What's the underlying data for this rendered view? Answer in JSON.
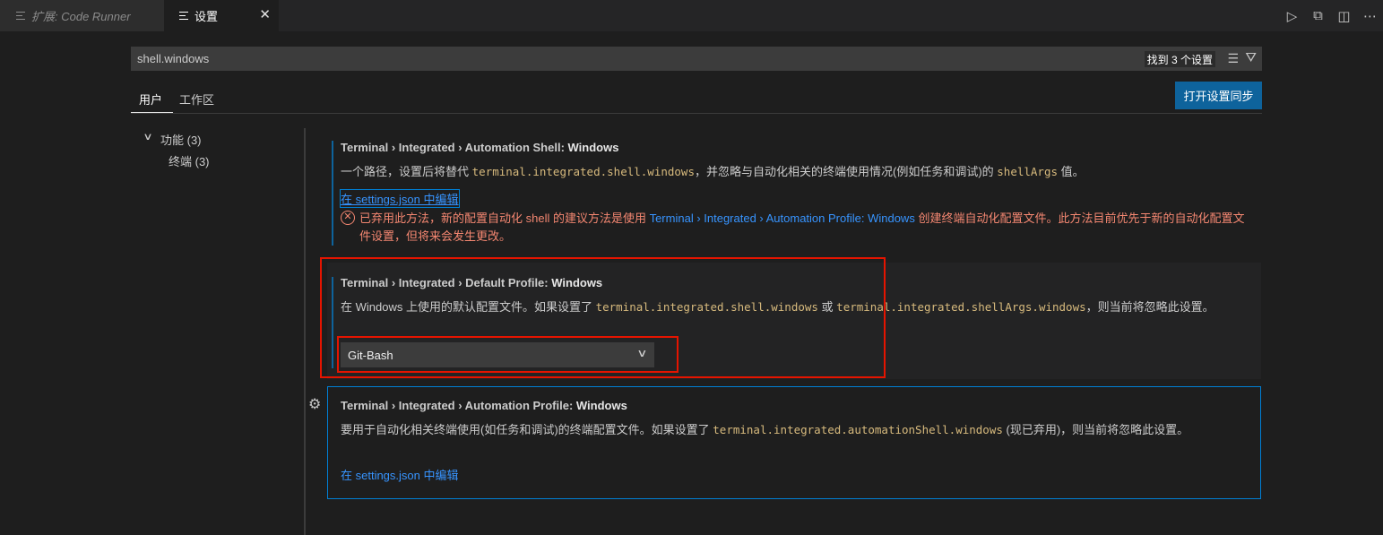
{
  "tabs": [
    {
      "label": "扩展: Code Runner",
      "active": false
    },
    {
      "label": "设置",
      "active": true
    }
  ],
  "tab_close": "✕",
  "editor_actions": [
    "run-icon",
    "open-settings-json-icon",
    "split-editor-icon",
    "more-actions-icon"
  ],
  "search": {
    "value": "shell.windows",
    "result_count": "找到 3 个设置"
  },
  "scopes": {
    "user": "用户",
    "workspace": "工作区"
  },
  "sync_button": "打开设置同步",
  "toc": {
    "group": "功能 (3)",
    "item": "终端 (3)"
  },
  "settings": [
    {
      "category": "Terminal › Integrated › Automation Shell: ",
      "name": "Windows",
      "desc_pre": "一个路径，设置后将替代 ",
      "desc_code1": "terminal.integrated.shell.windows",
      "desc_mid": "，并忽略与自动化相关的终端使用情况(例如任务和调试)的 ",
      "desc_code2": "shellArgs",
      "desc_post": " 值。",
      "edit_link": "在 settings.json 中编辑",
      "deprecation_pre": "已弃用此方法，新的配置自动化 shell 的建议方法是使用 ",
      "deprecation_link": "Terminal › Integrated › Automation Profile: Windows",
      "deprecation_post": " 创建终端自动化配置文件。此方法目前优先于新的自动化配置文件设置，但将来会发生更改。"
    },
    {
      "category": "Terminal › Integrated › Default Profile: ",
      "name": "Windows",
      "desc_pre": "在 Windows 上使用的默认配置文件。如果设置了 ",
      "desc_code1": "terminal.integrated.shell.windows",
      "desc_mid": " 或 ",
      "desc_code2": "terminal.integrated.shellArgs.windows",
      "desc_post": "，则当前将忽略此设置。",
      "select_value": "Git-Bash"
    },
    {
      "category": "Terminal › Integrated › Automation Profile: ",
      "name": "Windows",
      "desc_pre": "要用于自动化相关终端使用(如任务和调试)的终端配置文件。如果设置了 ",
      "desc_code1": "terminal.integrated.automationShell.windows",
      "desc_post": " (现已弃用)，则当前将忽略此设置。",
      "edit_link": "在 settings.json 中编辑"
    }
  ],
  "colors": {
    "accent": "#0e639c",
    "link": "#3794ff",
    "error": "#f48771",
    "highlight_box": "#e51400"
  }
}
